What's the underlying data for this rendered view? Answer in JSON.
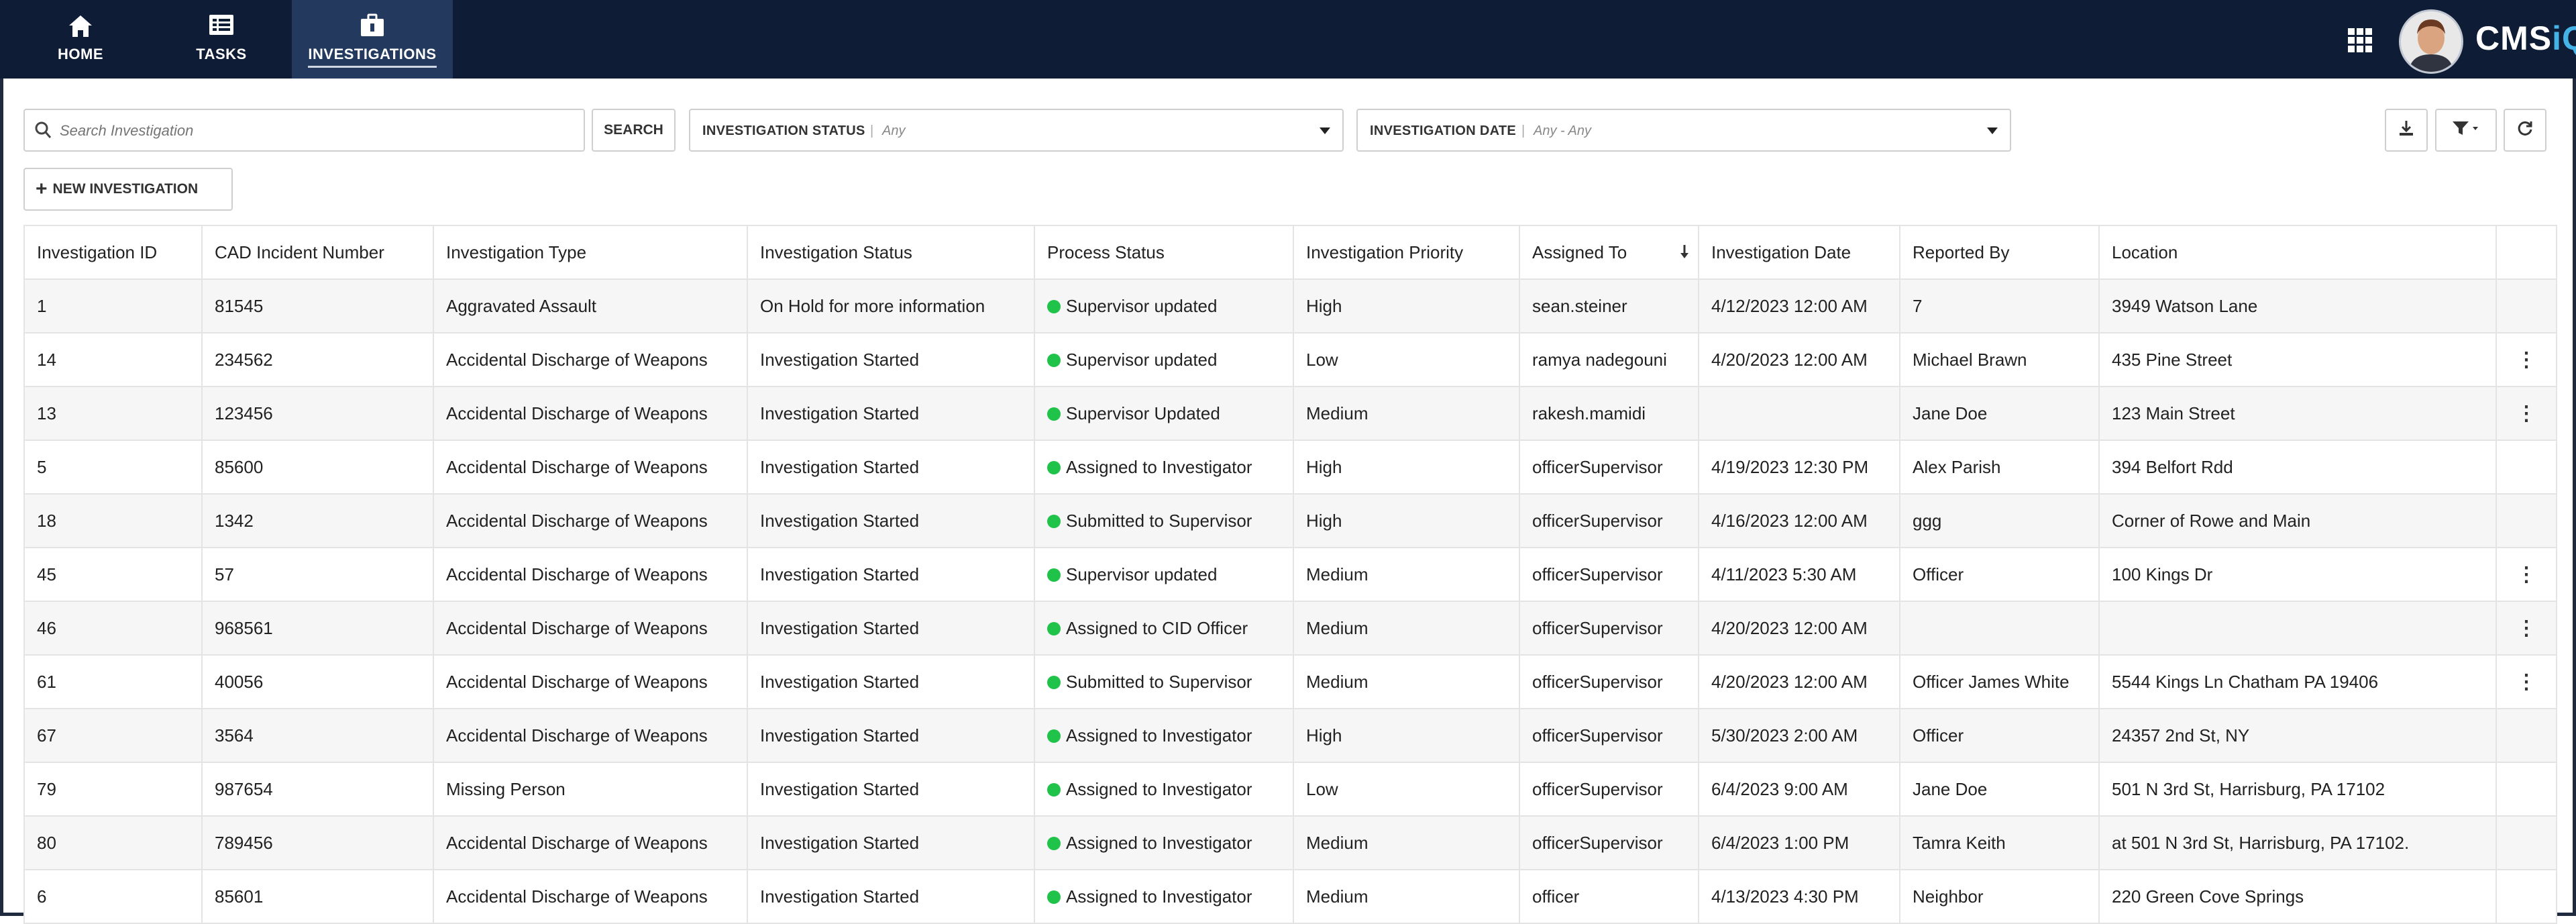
{
  "nav": {
    "items": [
      {
        "label": "HOME",
        "icon": "home-icon"
      },
      {
        "label": "TASKS",
        "icon": "tasks-icon"
      },
      {
        "label": "INVESTIGATIONS",
        "icon": "investigations-icon"
      }
    ],
    "active": "INVESTIGATIONS",
    "brand_a": "CMS",
    "brand_b": "iQ",
    "brand_accent_color": "#46b3e6",
    "bar_color": "#0f1c36"
  },
  "toolbar": {
    "search_placeholder": "Search Investigation",
    "search_button": "SEARCH",
    "status_filter": {
      "title": "INVESTIGATION STATUS",
      "value": "Any"
    },
    "date_filter": {
      "title": "INVESTIGATION DATE",
      "value": "Any - Any"
    },
    "new_button": "NEW INVESTIGATION",
    "new_button_icon": "plus-icon",
    "right_icons": [
      "download-icon",
      "filter-icon",
      "refresh-icon"
    ]
  },
  "table": {
    "headers": [
      "Investigation ID",
      "CAD Incident Number",
      "Investigation Type",
      "Investigation Status",
      "Process Status",
      "Investigation Priority",
      "Assigned To",
      "Investigation Date",
      "Reported By",
      "Location"
    ],
    "sort_icon": "sort-down-icon",
    "status_dot_color": "#1fc34a",
    "rows": [
      {
        "id": "1",
        "cad": "81545",
        "type": "Aggravated Assault",
        "status": "On Hold for more information",
        "process": "Supervisor updated",
        "priority": "High",
        "assigned": "sean.steiner",
        "date": "4/12/2023 12:00 AM",
        "reported": "7",
        "location": "3949 Watson Lane",
        "menu": false
      },
      {
        "id": "14",
        "cad": "234562",
        "type": "Accidental Discharge of Weapons",
        "status": "Investigation Started",
        "process": "Supervisor updated",
        "priority": "Low",
        "assigned": "ramya nadegouni",
        "date": "4/20/2023 12:00 AM",
        "reported": "Michael Brawn",
        "location": "435 Pine Street",
        "menu": true
      },
      {
        "id": "13",
        "cad": "123456",
        "type": "Accidental Discharge of Weapons",
        "status": "Investigation Started",
        "process": "Supervisor Updated",
        "priority": "Medium",
        "assigned": "rakesh.mamidi",
        "date": "",
        "reported": "Jane Doe",
        "location": "123 Main Street",
        "menu": true
      },
      {
        "id": "5",
        "cad": "85600",
        "type": "Accidental Discharge of Weapons",
        "status": "Investigation Started",
        "process": "Assigned to Investigator",
        "priority": "High",
        "assigned": "officerSupervisor",
        "date": "4/19/2023 12:30 PM",
        "reported": "Alex Parish",
        "location": "394 Belfort Rdd",
        "menu": false
      },
      {
        "id": "18",
        "cad": "1342",
        "type": "Accidental Discharge of Weapons",
        "status": "Investigation Started",
        "process": "Submitted to Supervisor",
        "priority": "High",
        "assigned": "officerSupervisor",
        "date": "4/16/2023 12:00 AM",
        "reported": "ggg",
        "location": "Corner of Rowe and Main",
        "menu": false
      },
      {
        "id": "45",
        "cad": "57",
        "type": "Accidental Discharge of Weapons",
        "status": "Investigation Started",
        "process": "Supervisor updated",
        "priority": "Medium",
        "assigned": "officerSupervisor",
        "date": "4/11/2023 5:30 AM",
        "reported": "Officer",
        "location": "100 Kings Dr",
        "menu": true
      },
      {
        "id": "46",
        "cad": "968561",
        "type": "Accidental Discharge of Weapons",
        "status": "Investigation Started",
        "process": "Assigned to CID Officer",
        "priority": "Medium",
        "assigned": "officerSupervisor",
        "date": "4/20/2023 12:00 AM",
        "reported": "",
        "location": "",
        "menu": true
      },
      {
        "id": "61",
        "cad": "40056",
        "type": "Accidental Discharge of Weapons",
        "status": "Investigation Started",
        "process": "Submitted to Supervisor",
        "priority": "Medium",
        "assigned": "officerSupervisor",
        "date": "4/20/2023 12:00 AM",
        "reported": "Officer James White",
        "location": "5544 Kings Ln Chatham PA 19406",
        "menu": true
      },
      {
        "id": "67",
        "cad": "3564",
        "type": "Accidental Discharge of Weapons",
        "status": "Investigation Started",
        "process": "Assigned to Investigator",
        "priority": "High",
        "assigned": "officerSupervisor",
        "date": "5/30/2023 2:00 AM",
        "reported": "Officer",
        "location": "24357 2nd St, NY",
        "menu": false
      },
      {
        "id": "79",
        "cad": "987654",
        "type": "Missing Person",
        "status": "Investigation Started",
        "process": "Assigned to Investigator",
        "priority": "Low",
        "assigned": "officerSupervisor",
        "date": "6/4/2023 9:00 AM",
        "reported": "Jane Doe",
        "location": "501 N 3rd St, Harrisburg, PA 17102",
        "menu": false
      },
      {
        "id": "80",
        "cad": "789456",
        "type": "Accidental Discharge of Weapons",
        "status": "Investigation Started",
        "process": "Assigned to Investigator",
        "priority": "Medium",
        "assigned": "officerSupervisor",
        "date": "6/4/2023 1:00 PM",
        "reported": "Tamra Keith",
        "location": "at 501 N 3rd St, Harrisburg, PA 17102.",
        "menu": false
      },
      {
        "id": "6",
        "cad": "85601",
        "type": "Accidental Discharge of Weapons",
        "status": "Investigation Started",
        "process": "Assigned to Investigator",
        "priority": "Medium",
        "assigned": "officer",
        "date": "4/13/2023 4:30 PM",
        "reported": "Neighbor",
        "location": "220 Green Cove Springs",
        "menu": false
      }
    ]
  }
}
